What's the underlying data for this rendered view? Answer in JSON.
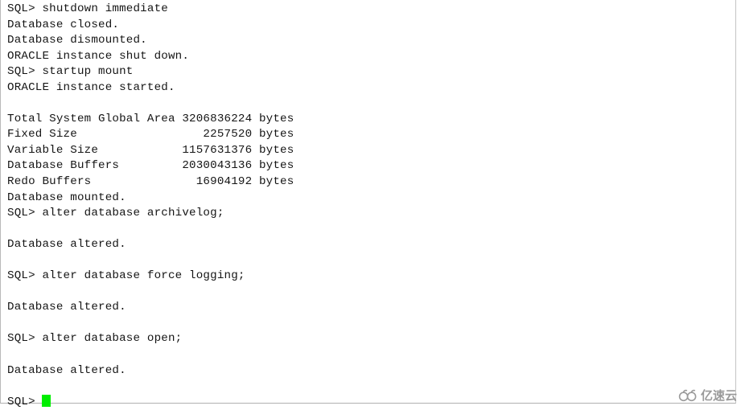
{
  "terminal": {
    "prompt": "SQL>",
    "cursor_color": "#00ee00",
    "text_color": "#151515",
    "background_color": "#ffffff",
    "lines": [
      "SQL> shutdown immediate",
      "Database closed.",
      "Database dismounted.",
      "ORACLE instance shut down.",
      "SQL> startup mount",
      "ORACLE instance started.",
      "",
      "Total System Global Area 3206836224 bytes",
      "Fixed Size                  2257520 bytes",
      "Variable Size            1157631376 bytes",
      "Database Buffers         2030043136 bytes",
      "Redo Buffers               16904192 bytes",
      "Database mounted.",
      "SQL> alter database archivelog;",
      "",
      "Database altered.",
      "",
      "SQL> alter database force logging;",
      "",
      "Database altered.",
      "",
      "SQL> alter database open;",
      "",
      "Database altered.",
      "",
      "SQL> "
    ],
    "sga_table": {
      "columns": [
        "component",
        "value",
        "unit"
      ],
      "rows": [
        {
          "component": "Total System Global Area",
          "value": "3206836224",
          "unit": "bytes"
        },
        {
          "component": "Fixed Size",
          "value": "2257520",
          "unit": "bytes"
        },
        {
          "component": "Variable Size",
          "value": "1157631376",
          "unit": "bytes"
        },
        {
          "component": "Database Buffers",
          "value": "2030043136",
          "unit": "bytes"
        },
        {
          "component": "Redo Buffers",
          "value": "16904192",
          "unit": "bytes"
        }
      ]
    },
    "commands": [
      "shutdown immediate",
      "startup mount",
      "alter database archivelog;",
      "alter database force logging;",
      "alter database open;"
    ],
    "status_messages": [
      "Database closed.",
      "Database dismounted.",
      "ORACLE instance shut down.",
      "ORACLE instance started.",
      "Database mounted.",
      "Database altered."
    ]
  },
  "watermark": {
    "text": "亿速云",
    "logo_icon": "cloud-icon",
    "color": "#8d8d8d"
  }
}
